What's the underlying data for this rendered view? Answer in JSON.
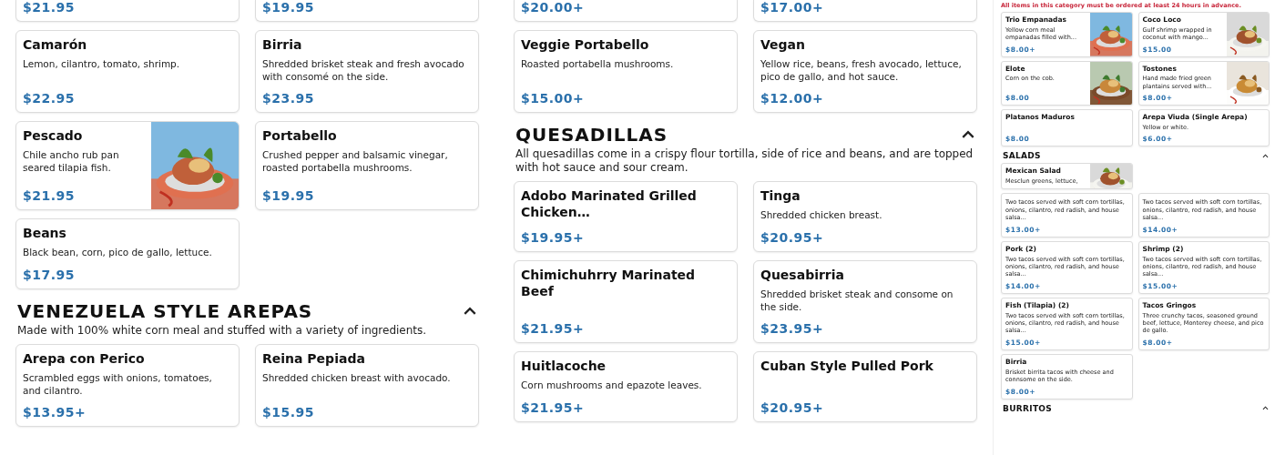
{
  "panels": [
    {
      "sections": [
        {
          "items": [
            {
              "kind": "cut",
              "price": "$21.95"
            },
            {
              "kind": "cut",
              "price": "$19.95"
            },
            {
              "kind": "card",
              "name": "Camarón",
              "description": "Lemon, cilantro, tomato, shrimp.",
              "price": "$22.95"
            },
            {
              "kind": "card",
              "name": "Birria",
              "description": "Shredded brisket steak and fresh avocado with consomé on the side.",
              "price": "$23.95"
            },
            {
              "kind": "card",
              "name": "Pescado",
              "description": "Chile ancho rub pan seared tilapia fish.",
              "price": "$21.95",
              "image": true
            },
            {
              "kind": "card",
              "name": "Portabello",
              "description": "Crushed pepper and balsamic vinegar, roasted portabella mushrooms.",
              "price": "$19.95"
            },
            {
              "kind": "card",
              "name": "Beans",
              "description": "Black bean, corn, pico de gallo, lettuce.",
              "price": "$17.95"
            }
          ]
        },
        {
          "heading": "VENEZUELA STYLE AREPAS",
          "expanded": true,
          "description": "Made with 100% white corn meal and stuffed with a variety of ingredients.",
          "items": [
            {
              "kind": "card",
              "name": "Arepa con Perico",
              "description": "Scrambled eggs with onions, tomatoes, and cilantro.",
              "price": "$13.95+"
            },
            {
              "kind": "card",
              "name": "Reina Pepiada",
              "description": "Shredded chicken breast with avocado.",
              "price": "$15.95"
            }
          ]
        }
      ]
    },
    {
      "sections": [
        {
          "items": [
            {
              "kind": "cut",
              "price": "$20.00+"
            },
            {
              "kind": "cut",
              "price": "$17.00+"
            },
            {
              "kind": "card",
              "name": "Veggie Portabello",
              "description": "Roasted portabella mushrooms.",
              "price": "$15.00+"
            },
            {
              "kind": "card",
              "name": "Vegan",
              "description": "Yellow rice, beans, fresh avocado, lettuce, pico de gallo, and hot sauce.",
              "price": "$12.00+"
            }
          ]
        },
        {
          "heading": "QUESADILLAS",
          "expanded": true,
          "description": "All quesadillas come in a crispy flour tortilla, side of rice and beans, and are topped with hot sauce and sour cream.",
          "items": [
            {
              "kind": "card",
              "name": "Adobo Marinated Grilled Chicken…",
              "price": "$19.95+"
            },
            {
              "kind": "card",
              "name": "Tinga",
              "description": "Shredded chicken breast.",
              "price": "$20.95+"
            },
            {
              "kind": "card",
              "name": "Chimichuhrry Marinated Beef",
              "price": "$21.95+"
            },
            {
              "kind": "card",
              "name": "Quesabirria",
              "description": "Shredded brisket steak and consome on the side.",
              "price": "$23.95+"
            },
            {
              "kind": "card",
              "name": "Huitlacoche",
              "description": "Corn mushrooms and epazote leaves.",
              "price": "$21.95+"
            },
            {
              "kind": "card",
              "name": "Cuban Style Pulled Pork",
              "price": "$20.95+"
            }
          ]
        }
      ]
    },
    {
      "sections": [
        {
          "note": "All items in this category must be ordered at least 24 hours in advance.",
          "items": [
            {
              "kind": "card",
              "name": "Trio Empanadas",
              "description": "Yellow corn meal empanadas filled with...",
              "price": "$8.00+",
              "image": true
            },
            {
              "kind": "card",
              "name": "Coco Loco",
              "description": "Gulf shrimp wrapped in coconut with mango...",
              "price": "$15.00",
              "image": true
            },
            {
              "kind": "card",
              "name": "Elote",
              "description": "Corn on the cob.",
              "price": "$8.00",
              "image": true
            },
            {
              "kind": "card",
              "name": "Tostones",
              "description": "Hand made fried green plantains served with...",
              "price": "$8.00+",
              "image": true
            },
            {
              "kind": "card",
              "name": "Platanos Maduros",
              "price": "$8.00"
            },
            {
              "kind": "card",
              "name": "Arepa Viuda (Single Arepa)",
              "description": "Yellow or white.",
              "price": "$6.00+"
            }
          ]
        },
        {
          "heading": "SALADS",
          "expanded": true,
          "items": [
            {
              "kind": "covered",
              "name": "Mexican Salad",
              "description": "Mesclun greens, lettuce,",
              "image": true
            },
            {
              "kind": "card",
              "description": "Two tacos served with soft corn tortillas, onions, cilantro, red radish, and house salsa...",
              "price": "$13.00+"
            },
            {
              "kind": "card",
              "description": "Two tacos served with soft corn tortillas, onions, cilantro, red radish, and house salsa...",
              "price": "$14.00+"
            },
            {
              "kind": "card",
              "name": "Pork (2)",
              "description": "Two tacos served with soft corn tortillas, onions, cilantro, red radish, and house salsa...",
              "price": "$14.00+"
            },
            {
              "kind": "card",
              "name": "Shrimp (2)",
              "description": "Two tacos served with soft corn tortillas, onions, cilantro, red radish, and house salsa...",
              "price": "$15.00+"
            },
            {
              "kind": "card",
              "name": "Fish (Tilapia) (2)",
              "description": "Two tacos served with soft corn tortillas, onions, cilantro, red radish, and house salsa...",
              "price": "$15.00+"
            },
            {
              "kind": "card",
              "name": "Tacos Gringos",
              "description": "Three crunchy tacos, seasoned ground beef, lettuce, Monterey cheese, and pico de gallo.",
              "price": "$8.00+"
            },
            {
              "kind": "card",
              "name": "Birria",
              "description": "Brisket birrita tacos with cheese and connsome on the side.",
              "price": "$8.00+"
            }
          ]
        },
        {
          "heading": "BURRITOS",
          "expanded": true
        }
      ]
    }
  ]
}
